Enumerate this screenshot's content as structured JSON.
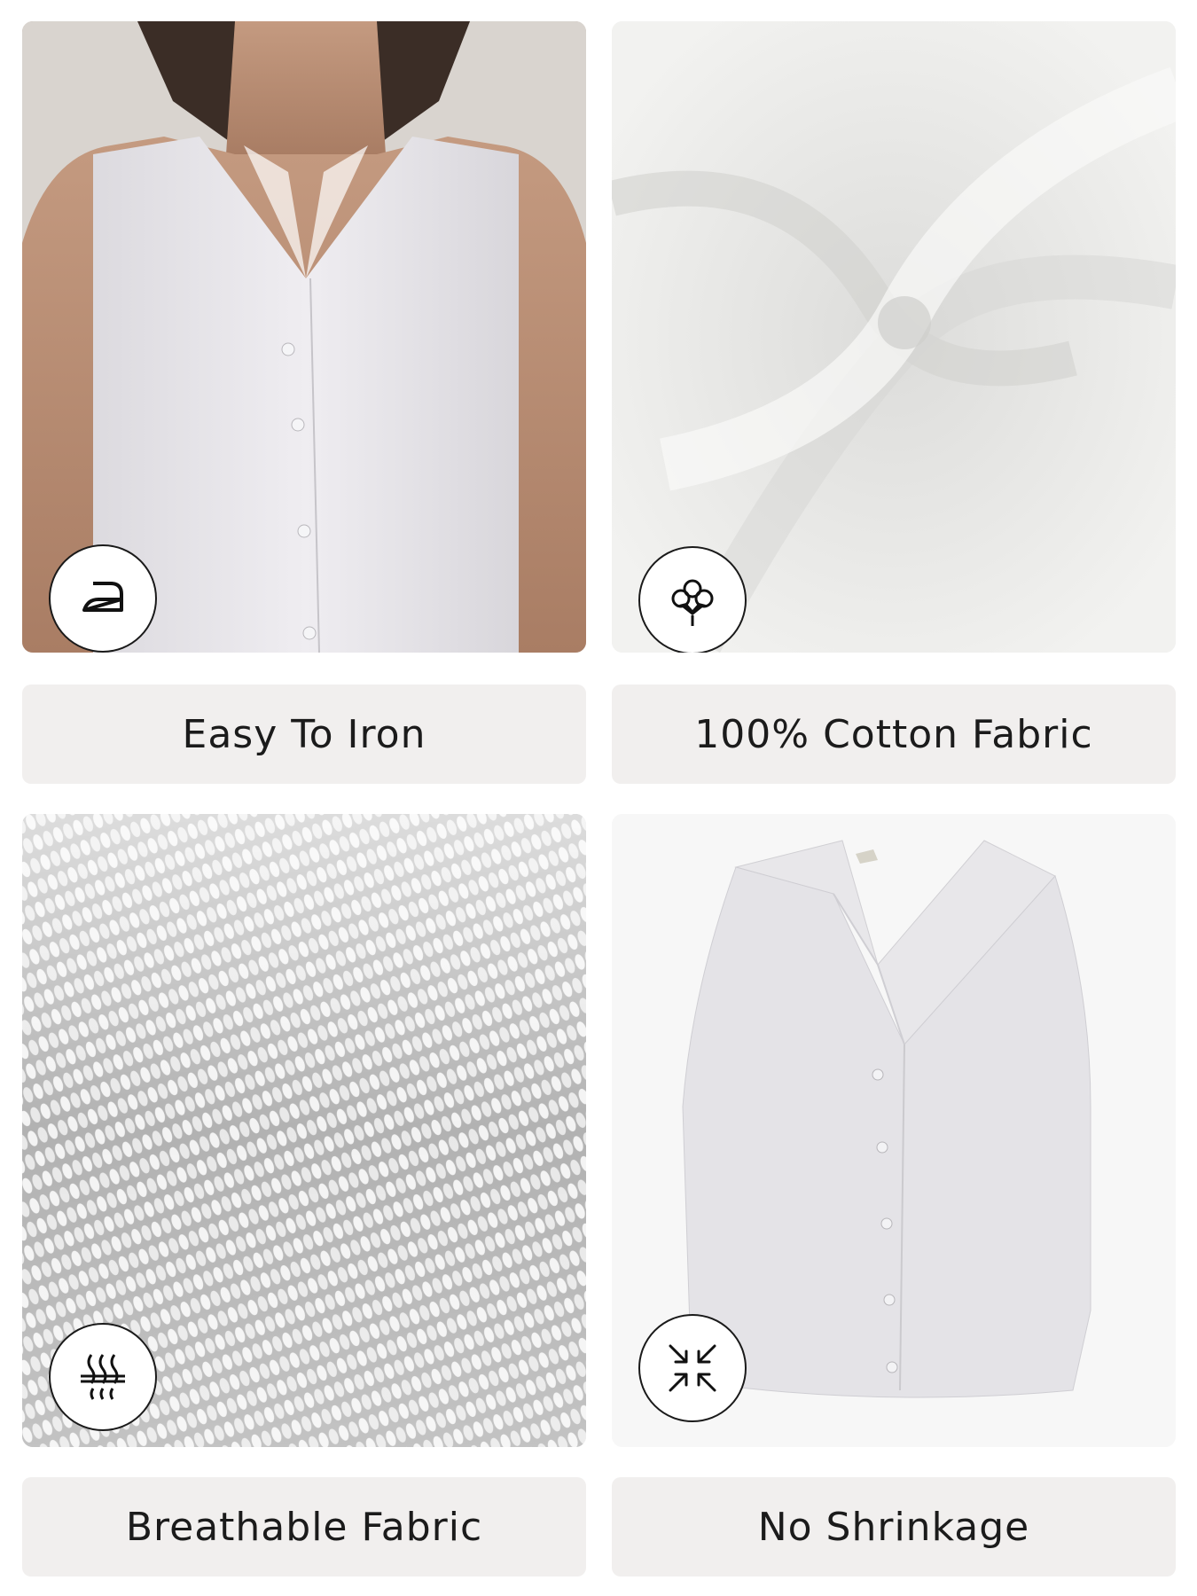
{
  "features": [
    {
      "label": "Easy To Iron",
      "icon": "iron-icon"
    },
    {
      "label": "100% Cotton Fabric",
      "icon": "cotton-flower-icon"
    },
    {
      "label": "Breathable Fabric",
      "icon": "breathable-heat-icon"
    },
    {
      "label": "No Shrinkage",
      "icon": "no-shrink-arrows-icon"
    }
  ],
  "colors": {
    "label_bg": "#f1efee",
    "text": "#1b1b1b",
    "fabric": "#eeeeee"
  }
}
